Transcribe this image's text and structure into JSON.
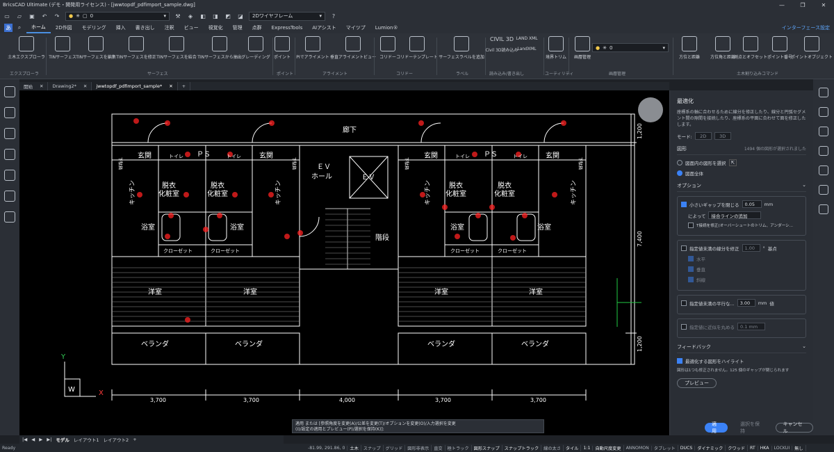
{
  "title": "BricsCAD Ultimate (デモ・開発用ライセンス) - [jwwtopdf_pdfimport_sample.dwg]",
  "quickbar": {
    "layer_value": "0",
    "view_mode": "2Dワイヤフレーム"
  },
  "menu": {
    "tabs": [
      "ホーム",
      "2D作図",
      "モデリング",
      "挿入",
      "書き出し",
      "注釈",
      "ビュー",
      "視覚化",
      "管理",
      "点群",
      "ExpressTools",
      "AIアシスト",
      "マイツプ",
      "Lumion®"
    ],
    "active": "ホーム",
    "interface_settings": "インターフェース設定"
  },
  "ribbon": {
    "buttons": [
      "土木エクスプローラ",
      "TINサーフェス",
      "TINサーフェスを編集",
      "TINサーフェスを修正",
      "TINサーフェスを結合",
      "TINサーフェスから抽出",
      "グレーディング",
      "ポイント",
      "PIでアライメント",
      "垂直アライメントビュー",
      "コリドー",
      "コリドーテンプレート",
      "サーフェスラベルを追加",
      "Civil 3D読み込み",
      "LandXML",
      "境界トリム",
      "画層管理",
      "方位と距離",
      "方位角と距離",
      "測点とオフセット",
      "ポイント番号",
      "ポイントオブジェクト"
    ],
    "groups": [
      "エクスプローラ",
      "サーフェス",
      "ポイント",
      "アライメント",
      "コリドー",
      "ラベル",
      "読み込み/書き出し",
      "ユーティリティ",
      "画層管理",
      "土木割り込みコマンド"
    ],
    "civil_label": "CIVIL 3D",
    "landxml_label": "LAND XML",
    "layer_value": "0"
  },
  "doctabs": [
    "開始",
    "Drawing2*",
    "jwwtopdf_pdfimport_sample*"
  ],
  "drawing": {
    "corridor": "廊下",
    "ev_hall": "ＥＶ\nホール",
    "ev": "ＥＶ",
    "stairs": "階段",
    "entrance": "玄関",
    "toilet": "トイレ",
    "ps": "ＰＳ",
    "shoes": "下駄箱",
    "dressing": "脱衣",
    "powder": "化粧室",
    "kitchen": "キッチン",
    "bath": "浴室",
    "closet": "クローゼット",
    "western_room": "洋室",
    "veranda": "ベランダ",
    "dim_bottom": [
      "3,700",
      "3,700",
      "4,000",
      "3,700",
      "3,700"
    ],
    "dim_right": [
      "1,200",
      "7,400",
      "1,200"
    ],
    "axis_x": "X",
    "axis_y": "Y",
    "axis_w": "W"
  },
  "command_line": {
    "line1": "適用 または [参照角度を変更(A)/公差を変更(T)/オプションを変更(O)/入力選択を変更",
    "line2": "(I)/設定の適用とプレビュー(P)/選択を保持(K)]:"
  },
  "panel": {
    "title": "最適化",
    "description": "座標系の軸に合わせるために線分を修正したり、線分と円弧セグメント間の隙間を接続したり、座標系の平面に合わせて面を修正したします。",
    "mode_label": "モード:",
    "mode_2d": "2D",
    "mode_3d": "3D",
    "shape_label": "図形",
    "shape_count": "1494 個の図形が選択されました",
    "radio_in_shape": "図面内の図形を選択",
    "radio_all": "図面全体",
    "options_label": "オプション",
    "close_gaps": "小さいギャップを閉じる",
    "gap_value": "0.05",
    "gap_unit": "mm",
    "by_label": "によって",
    "by_value": "接合ラインの追加",
    "t_fix": "T接続を修正(オーバーシュートのトリム、アンダーシ...",
    "fix_lines": "指定値未満の線分を修正",
    "fix_value": "1.00",
    "fix_unit": "°",
    "base_point": "基点",
    "horizontal": "水平",
    "vertical": "垂直",
    "oblique": "斜線",
    "parallel": "指定値未満の平行な...",
    "parallel_value": "3.00",
    "parallel_unit": "mm",
    "parallel_suffix": "値",
    "approx": "指定値に近似を丸める",
    "approx_value": "0.1 mm",
    "feedback_label": "フィードバック",
    "highlight": "最適化する図形をハイライト",
    "feedback_note": "図形は1つも修正されません。125 個のギャップが閉じられます",
    "preview": "プレビュー",
    "apply": "適用",
    "keep": "選択を保持",
    "cancel": "キャンセル"
  },
  "layout_tabs": [
    "モデル",
    "レイアウト1",
    "レイアウト2"
  ],
  "status": {
    "ready": "Ready",
    "coords": "-81.99, 291.86, 0",
    "items": [
      "土木",
      "スナップ",
      "グリッド",
      "図形非表示",
      "直交",
      "極トラック",
      "図形スナップ",
      "スナップトラック",
      "線の太さ",
      "タイル",
      "1:1",
      "自動尺度変更",
      "ANNOMON",
      "タブレット",
      "DUCS",
      "ダイナミック",
      "クワッド",
      "RT",
      "HKA",
      "LOCKUI",
      "無し"
    ]
  }
}
